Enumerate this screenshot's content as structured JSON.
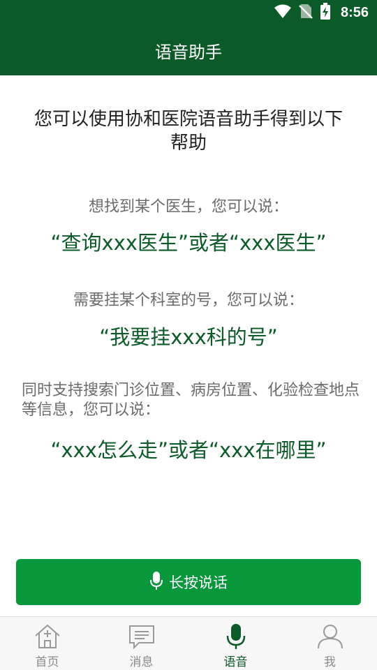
{
  "status_bar": {
    "time": "8:56",
    "icons": [
      "wifi-icon",
      "no-sim-icon",
      "battery-charging-icon"
    ]
  },
  "app_bar": {
    "title": "语音助手"
  },
  "main": {
    "intro": "您可以使用协和医院语音助手得到以下帮助",
    "sections": [
      {
        "prompt": "想找到某个医生，您可以说：",
        "example": "“查询xxx医生”或者“xxx医生”"
      },
      {
        "prompt": "需要挂某个科室的号，您可以说：",
        "example": "“我要挂xxx科的号”"
      },
      {
        "prompt": "同时支持搜索门诊位置、病房位置、化验检查地点等信息，您可以说：",
        "example": "“xxx怎么走”或者“xxx在哪里”"
      }
    ]
  },
  "talk_button": {
    "label": "长按说话",
    "icon": "microphone-icon"
  },
  "tab_bar": {
    "tabs": [
      {
        "label": "首页",
        "icon": "home-icon",
        "active": false
      },
      {
        "label": "消息",
        "icon": "message-icon",
        "active": false
      },
      {
        "label": "语音",
        "icon": "microphone-icon",
        "active": true
      },
      {
        "label": "我",
        "icon": "user-icon",
        "active": false
      }
    ]
  },
  "colors": {
    "primary_dark": "#0b5a28",
    "button_green": "#08973a",
    "prompt_gray": "#6b6b6b",
    "tab_inactive": "#8a8a8a"
  }
}
